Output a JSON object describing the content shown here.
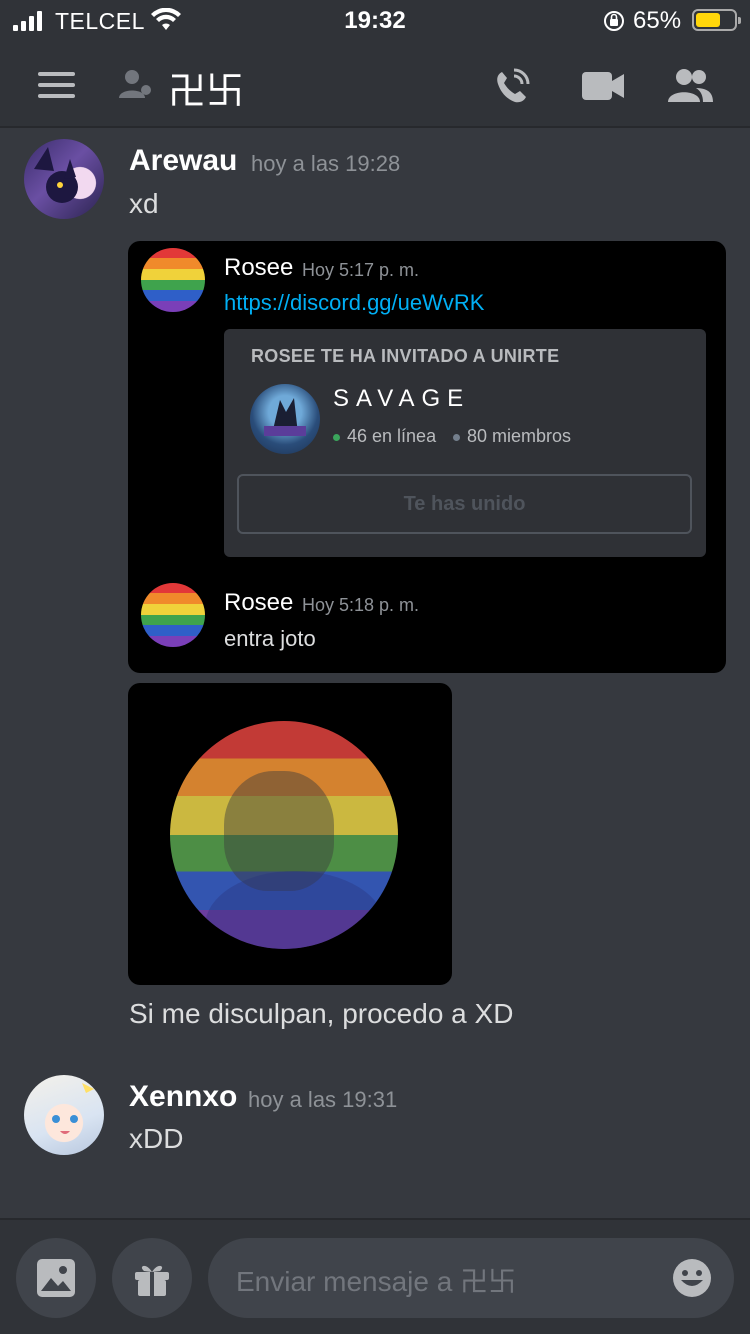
{
  "status_bar": {
    "carrier": "TELCEL",
    "time": "19:32",
    "battery": "65%",
    "battery_level": 0.65,
    "battery_color": "#ffd60a"
  },
  "header": {
    "channel_name": "卍卐",
    "icons": [
      "menu-icon",
      "person-icon",
      "call-icon",
      "video-icon",
      "members-icon"
    ]
  },
  "messages": [
    {
      "author": "Arewau",
      "timestamp": "hoy a las 19:28",
      "text": "xd",
      "quote": {
        "items": [
          {
            "author": "Rosee",
            "timestamp": "Hoy 5:17 p. m.",
            "link": "https://discord.gg/ueWvRK"
          },
          {
            "author": "Rosee",
            "timestamp": "Hoy 5:18 p. m.",
            "text": "entra joto"
          }
        ],
        "invite": {
          "title": "ROSEE TE HA INVITADO A UNIRTE",
          "server_name": "SAVAGE",
          "online": "46 en línea",
          "members": "80 miembros",
          "online_color": "#3ba55c",
          "members_color": "#747f8d",
          "button": "Te has unido"
        }
      },
      "follow_text": "Si me disculpan, procedo a XD"
    },
    {
      "author": "Xennxo",
      "timestamp": "hoy a las 19:31",
      "text": "xDD"
    }
  ],
  "composer": {
    "placeholder": "Enviar mensaje a 卍卐",
    "icons": [
      "image-icon",
      "gift-icon",
      "emoji-icon"
    ]
  },
  "colors": {
    "background": "#36393f",
    "header": "#303338",
    "link": "#00aff4"
  }
}
